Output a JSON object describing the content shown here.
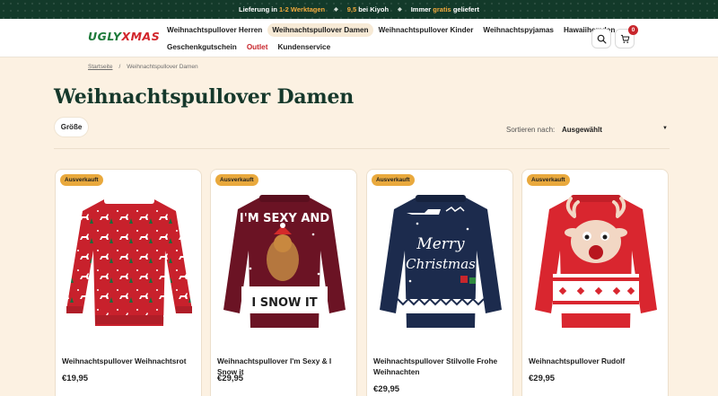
{
  "topbar": {
    "part1_pre": "Lieferung in",
    "part1_hl": "1-2 Werktagen",
    "part2_hl": "9,5",
    "part2_post": "bei Kiyoh",
    "part3_pre": "Immer",
    "part3_hl": "gratis",
    "part3_post": "geliefert"
  },
  "logo": {
    "ugly": "UGLY",
    "xmas": "XMAS"
  },
  "nav": {
    "row1": [
      "Weihnachtspullover Herren",
      "Weihnachtspullover Damen",
      "Weihnachtspullover Kinder",
      "Weihnachtspyjamas",
      "Hawaiihemden"
    ],
    "row2": [
      "Geschenkgutschein",
      "Outlet",
      "Kundenservice"
    ]
  },
  "cart": {
    "count": "0"
  },
  "breadcrumb": {
    "home": "Startseite",
    "separator": "/",
    "current": "Weihnachtspullover Damen"
  },
  "page": {
    "title": "Weihnachtspullover Damen"
  },
  "filters": {
    "size_label": "Größe",
    "sort_label": "Sortieren nach:",
    "sort_value": "Ausgewählt"
  },
  "products": [
    {
      "badge": "Ausverkauft",
      "name": "Weihnachtspullover Weihnachtsrot",
      "price": "€19,95"
    },
    {
      "badge": "Ausverkauft",
      "name": "Weihnachtspullover I'm Sexy & I Snow it",
      "price": "€29,95",
      "print_top": "I'M SEXY AND",
      "print_bottom": "I SNOW IT"
    },
    {
      "badge": "Ausverkauft",
      "name": "Weihnachtspullover Stilvolle Frohe Weihnachten",
      "price": "€29,95",
      "print_top": "Merry",
      "print_bottom": "Christmas"
    },
    {
      "badge": "Ausverkauft",
      "name": "Weihnachtspullover Rudolf",
      "price": "€29,95"
    }
  ],
  "colors": {
    "topbar": "#133a2a",
    "accent_orange": "#f2a93b",
    "title_green": "#15382b",
    "outlet_red": "#c8262c",
    "badge": "#e9a93d",
    "bg": "#fcf1e2"
  }
}
